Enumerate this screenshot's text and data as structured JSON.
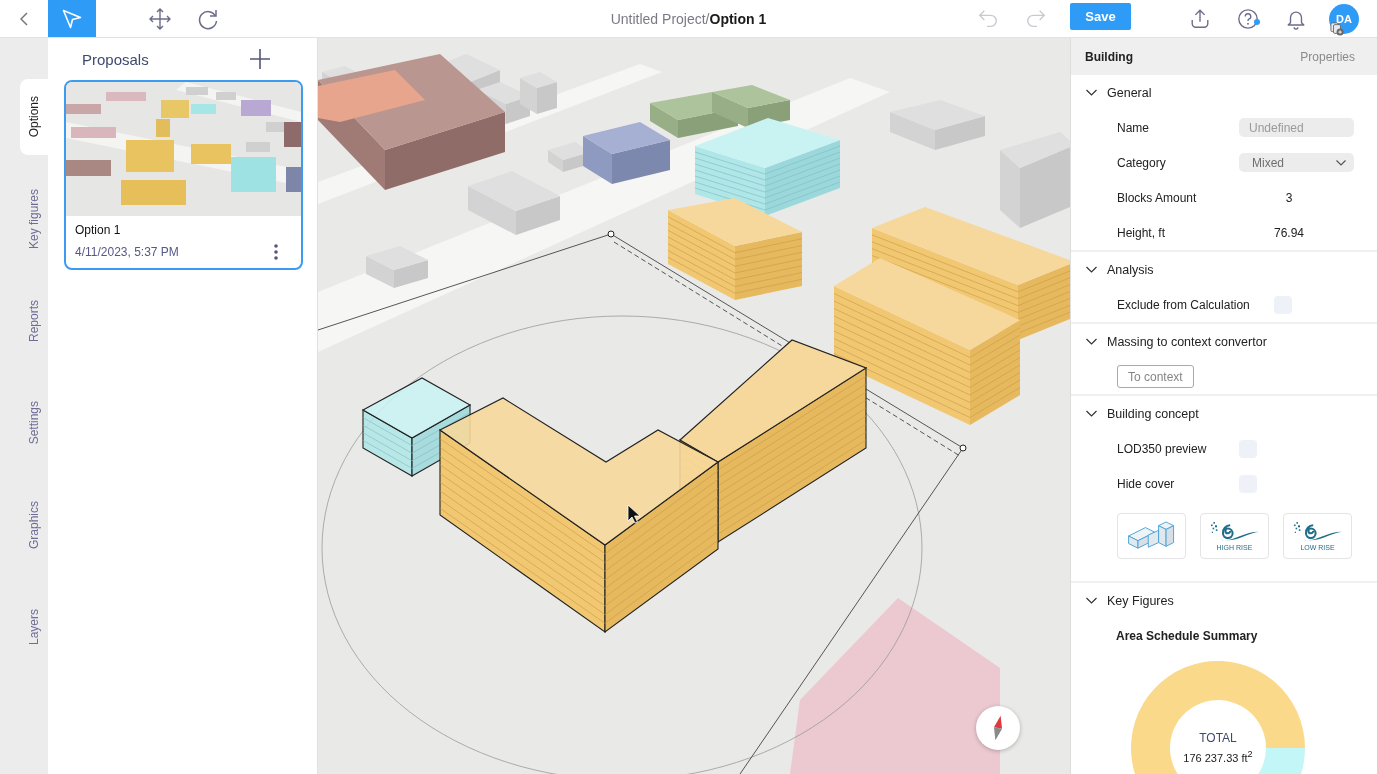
{
  "top_bar": {
    "tools": [
      {
        "kind": "select",
        "selected": true
      },
      {
        "kind": "move",
        "selected": false
      },
      {
        "kind": "rotate",
        "selected": false
      }
    ],
    "title": "Untitled Project/**Option 1**",
    "history": [
      {
        "kind": "undo",
        "disabled": true
      },
      {
        "kind": "redo",
        "disabled": true
      }
    ],
    "save_button": "Save",
    "actions": [
      {
        "kind": "upload",
        "badge": false
      },
      {
        "kind": "help",
        "badge": true
      },
      {
        "kind": "notifications",
        "badge": false
      }
    ],
    "avatar": {
      "initials": "DA"
    }
  },
  "side_tabs": [
    {
      "label": "Options",
      "selected": true
    },
    {
      "label": "Key figures",
      "selected": false
    },
    {
      "label": "Reports",
      "selected": false
    },
    {
      "label": "Settings",
      "selected": false
    },
    {
      "label": "Graphics",
      "selected": false
    },
    {
      "label": "Layers",
      "selected": false
    }
  ],
  "proposals_panel": {
    "title": "Proposals",
    "cards": [
      {
        "name": "Option 1",
        "date": "4/11/2023, 5:37 PM",
        "selected": true
      }
    ]
  },
  "properties_panel": {
    "header": {
      "title": "Building",
      "tab": "Properties"
    },
    "sections": [
      {
        "title": "General",
        "expanded": true,
        "rows": [
          {
            "kind": "input",
            "label": "Name",
            "placeholder": "Undefined"
          },
          {
            "kind": "select",
            "label": "Category",
            "value": "Mixed"
          },
          {
            "kind": "value",
            "label": "Blocks Amount",
            "value": "3"
          },
          {
            "kind": "value",
            "label": "Height, ft",
            "value": "76.94"
          }
        ]
      },
      {
        "title": "Analysis",
        "expanded": true,
        "rows": [
          {
            "kind": "checkbox",
            "label": "Exclude from Calculation",
            "checked": false
          }
        ]
      },
      {
        "title": "Massing to context convertor",
        "expanded": true,
        "rows": [
          {
            "kind": "button",
            "label": "To context"
          }
        ]
      },
      {
        "title": "Building concept",
        "expanded": true,
        "rows": [
          {
            "kind": "checkbox",
            "label": "LOD350 preview",
            "checked": false
          },
          {
            "kind": "checkbox",
            "label": "Hide cover",
            "checked": false
          },
          {
            "kind": "tiles",
            "tiles": [
              {
                "kind": "building"
              },
              {
                "kind": "logo",
                "label": "HIGH RISE"
              },
              {
                "kind": "logo",
                "label": "LOW RISE"
              }
            ]
          }
        ]
      },
      {
        "title": "Key Figures",
        "expanded": true,
        "rows": [
          {
            "kind": "donut",
            "title": "Area Schedule Summary",
            "center_label": "TOTAL",
            "total": "176 237.33 ft$^{2}$"
          }
        ]
      }
    ]
  }
}
